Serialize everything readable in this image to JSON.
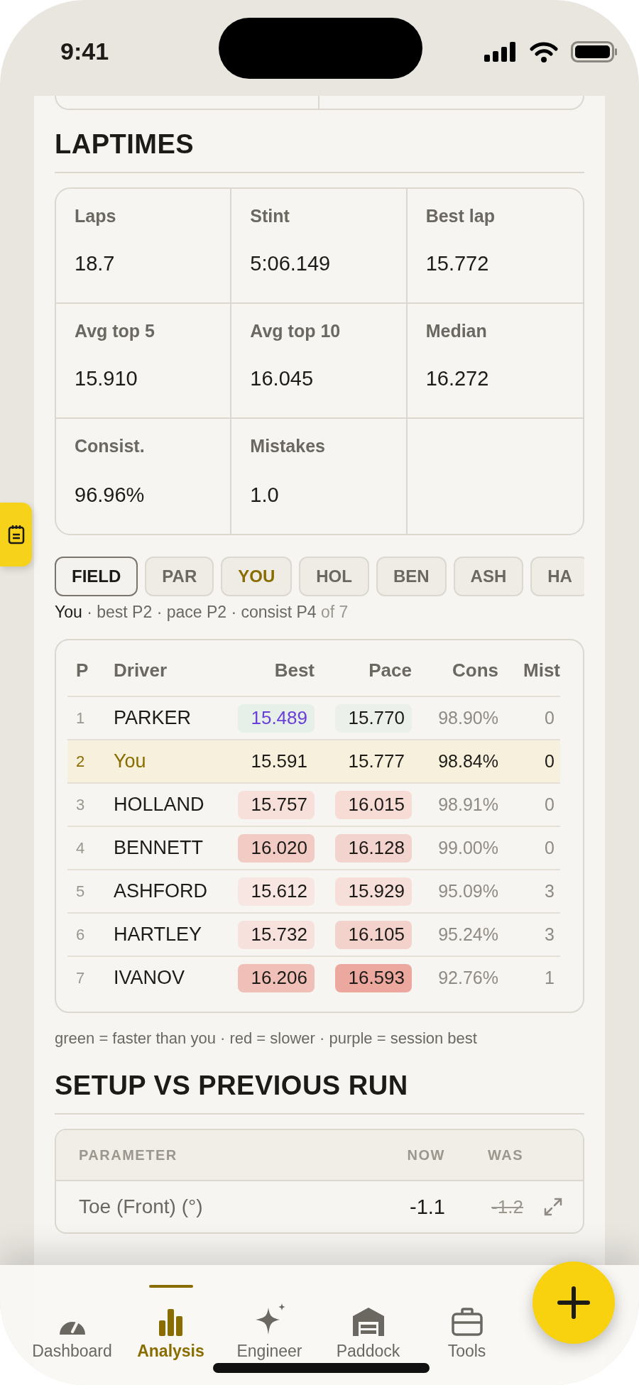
{
  "status_bar": {
    "time": "9:41"
  },
  "laptimes": {
    "title": "LAPTIMES",
    "stats": [
      {
        "label": "Laps",
        "value": "18.7"
      },
      {
        "label": "Stint",
        "value": "5:06.149"
      },
      {
        "label": "Best lap",
        "value": "15.772"
      },
      {
        "label": "Avg top 5",
        "value": "15.910"
      },
      {
        "label": "Avg top 10",
        "value": "16.045"
      },
      {
        "label": "Median",
        "value": "16.272"
      },
      {
        "label": "Consist.",
        "value": "96.96%"
      },
      {
        "label": "Mistakes",
        "value": "1.0"
      }
    ]
  },
  "filters": [
    {
      "label": "FIELD",
      "selected": true,
      "you": false
    },
    {
      "label": "PAR",
      "selected": false,
      "you": false
    },
    {
      "label": "YOU",
      "selected": false,
      "you": true
    },
    {
      "label": "HOL",
      "selected": false,
      "you": false
    },
    {
      "label": "BEN",
      "selected": false,
      "you": false
    },
    {
      "label": "ASH",
      "selected": false,
      "you": false
    },
    {
      "label": "HA",
      "selected": false,
      "you": false
    }
  ],
  "summary": {
    "driver": "You",
    "ranks": "· best P2 · pace P2 · consist P4",
    "total": "of 7"
  },
  "table": {
    "columns": [
      "P",
      "Driver",
      "Best",
      "Pace",
      "Cons",
      "Mist"
    ],
    "rows": [
      {
        "p": "1",
        "driver": "PARKER",
        "you": false,
        "best": {
          "value": "15.489",
          "color": "#e6efe8",
          "session_best": true
        },
        "pace": {
          "value": "15.770",
          "color": "#ebf0ea",
          "session_best": false
        },
        "cons": "98.90%",
        "mist": "0"
      },
      {
        "p": "2",
        "driver": "You",
        "you": true,
        "best": {
          "value": "15.591",
          "session_best": false
        },
        "pace": {
          "value": "15.777",
          "session_best": false
        },
        "cons": "98.84%",
        "mist": "0"
      },
      {
        "p": "3",
        "driver": "HOLLAND",
        "you": false,
        "best": {
          "value": "15.757",
          "color": "#f7e0da",
          "session_best": false
        },
        "pace": {
          "value": "16.015",
          "color": "#f6dcd5",
          "session_best": false
        },
        "cons": "98.91%",
        "mist": "0"
      },
      {
        "p": "4",
        "driver": "BENNETT",
        "you": false,
        "best": {
          "value": "16.020",
          "color": "#f2cbc4",
          "session_best": false
        },
        "pace": {
          "value": "16.128",
          "color": "#f3d3cd",
          "session_best": false
        },
        "cons": "99.00%",
        "mist": "0"
      },
      {
        "p": "5",
        "driver": "ASHFORD",
        "you": false,
        "best": {
          "value": "15.612",
          "color": "#f8e6e2",
          "session_best": false
        },
        "pace": {
          "value": "15.929",
          "color": "#f6dfd9",
          "session_best": false
        },
        "cons": "95.09%",
        "mist": "3"
      },
      {
        "p": "6",
        "driver": "HARTLEY",
        "you": false,
        "best": {
          "value": "15.732",
          "color": "#f7e1dc",
          "session_best": false
        },
        "pace": {
          "value": "16.105",
          "color": "#f3d2cb",
          "session_best": false
        },
        "cons": "95.24%",
        "mist": "3"
      },
      {
        "p": "7",
        "driver": "IVANOV",
        "you": false,
        "best": {
          "value": "16.206",
          "color": "#f0c0b8",
          "session_best": false
        },
        "pace": {
          "value": "16.593",
          "color": "#eca89f",
          "session_best": false
        },
        "cons": "92.76%",
        "mist": "1"
      }
    ]
  },
  "legend": "green = faster than you · red = slower · purple = session best",
  "setup": {
    "title": "SETUP VS PREVIOUS RUN",
    "columns": [
      "PARAMETER",
      "NOW",
      "WAS"
    ],
    "rows": [
      {
        "parameter": "Toe (Front) (°)",
        "now": "-1.1",
        "was": "-1.2"
      }
    ]
  },
  "nav": [
    {
      "label": "Dashboard",
      "selected": false
    },
    {
      "label": "Analysis",
      "selected": true
    },
    {
      "label": "Engineer",
      "selected": false
    },
    {
      "label": "Paddock",
      "selected": false
    },
    {
      "label": "Tools",
      "selected": false
    }
  ]
}
